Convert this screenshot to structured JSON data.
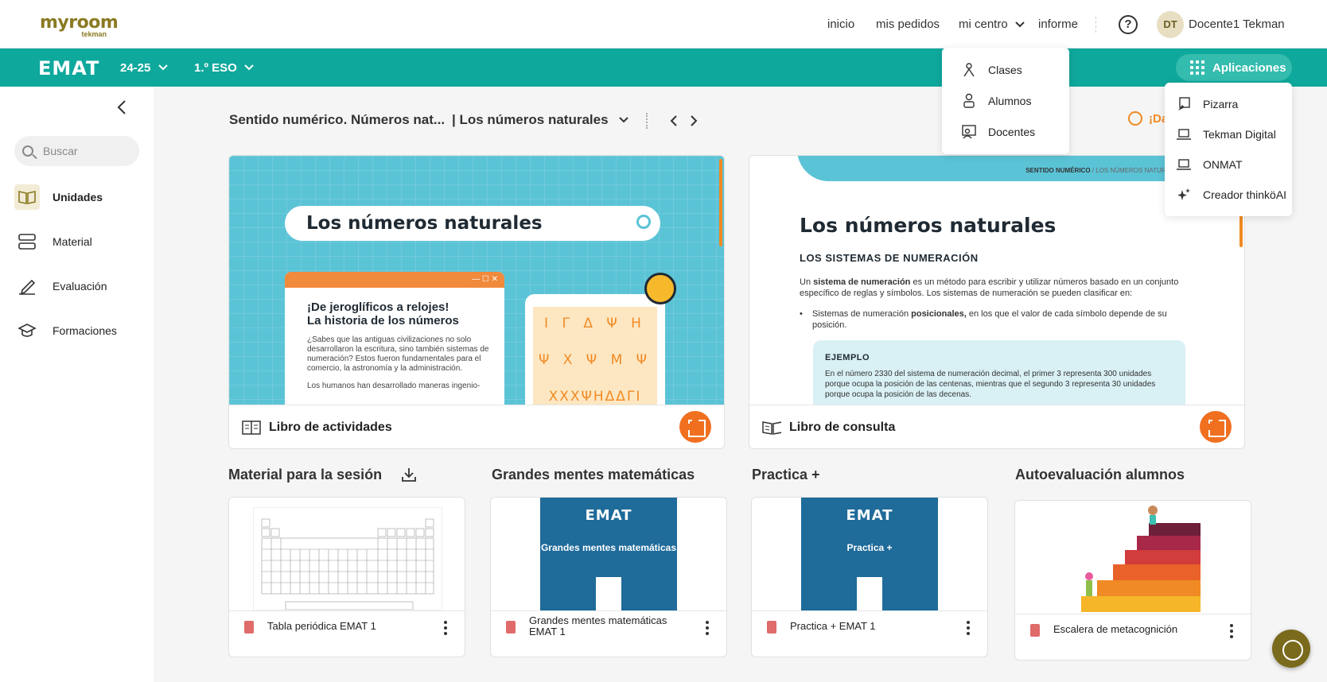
{
  "brand": {
    "logo": "myroom",
    "logo_sub": "tekman"
  },
  "topnav": {
    "inicio": "inicio",
    "pedidos": "mis pedidos",
    "centro": "mi centro",
    "informe": "informe",
    "avatar_initials": "DT",
    "user": "Docente1 Tekman"
  },
  "greenbar": {
    "logo": "EMAT",
    "year": "24-25",
    "grade": "1.º ESO",
    "apps_label": "Aplicaciones"
  },
  "sidebar": {
    "search_placeholder": "Buscar",
    "items": [
      {
        "label": "Unidades",
        "icon": "book-open-icon"
      },
      {
        "label": "Material",
        "icon": "stack-icon"
      },
      {
        "label": "Evaluación",
        "icon": "pen-icon"
      },
      {
        "label": "Formaciones",
        "icon": "graduation-cap-icon"
      }
    ]
  },
  "main": {
    "unit": "Sentido numérico. Números nat...",
    "lesson": "| Los números naturales",
    "dial_label": "¡Da",
    "cards": [
      {
        "label": "Libro de actividades"
      },
      {
        "label": "Libro de consulta"
      }
    ],
    "activities_preview": {
      "search_text": "Los números naturales",
      "window_controls": "— ☐ ✕",
      "heading_1": "¡De jeroglíficos a relojes!",
      "heading_2": "La historia de los números",
      "para_1": "¿Sabes que las antiguas civilizaciones no solo desarrollaron la escritura, sino también sistemas de numeración? Estos fueron fundamentales para el comercio, la astronomía y la administración.",
      "para_2": "Los humanos han desarrollado maneras ingenio-",
      "glyph_row_1": "I Γ Δ Ψ H",
      "glyph_row_2": "Ψ X Ψ M Ψ",
      "glyph_row_3": "XXXΨHΔΔΓI"
    },
    "consulta_preview": {
      "crumb_bold": "SENTIDO NUMÉRICO",
      "crumb_rest": "/ LOS NÚMEROS NATURALES",
      "title": "Los números naturales",
      "heading": "LOS SISTEMAS DE NUMERACIÓN",
      "para_pre": "Un ",
      "para_bold": "sistema de numeración",
      "para_post": " es un método para escribir y utilizar números basado en un conjunto específico de reglas y símbolos. Los sistemas de numeración se pueden clasificar en:",
      "li_pre": "Sistemas de numeración ",
      "li_bold": "posicionales,",
      "li_post": " en los que el valor de cada símbolo depende de su posición.",
      "example_title": "EJEMPLO",
      "example_text": "En el número 2330 del sistema de numeración decimal, el primer 3 representa 300 unidades porque ocupa la posición de las centenas, mientras que el segundo 3 representa 30 unidades porque ocupa la posición de las decenas."
    },
    "sections": [
      {
        "title": "Material para la sesión",
        "item": "Tabla periódica EMAT 1"
      },
      {
        "title": "Grandes mentes matemáticas",
        "item": "Grandes mentes matemáticas EMAT 1",
        "cover_logo": "EMAT",
        "cover_title": "Grandes mentes matemáticas"
      },
      {
        "title": "Practica +",
        "item": "Practica + EMAT 1",
        "cover_logo": "EMAT",
        "cover_title": "Practica +"
      },
      {
        "title": "Autoevaluación alumnos",
        "item": "Escalera de metacognición"
      }
    ]
  },
  "centro_menu": [
    {
      "label": "Clases",
      "icon": "class-icon"
    },
    {
      "label": "Alumnos",
      "icon": "student-icon"
    },
    {
      "label": "Docentes",
      "icon": "teacher-icon"
    }
  ],
  "apps_menu": [
    {
      "label": "Pizarra",
      "icon": "whiteboard-icon"
    },
    {
      "label": "Tekman Digital",
      "icon": "laptop-icon"
    },
    {
      "label": "ONMAT",
      "icon": "laptop-icon"
    },
    {
      "label": "Creador thinköAI",
      "icon": "sparkle-icon"
    }
  ],
  "colors": {
    "teal": "#0fa89c",
    "orange": "#f07020",
    "olive": "#8a7a22"
  }
}
